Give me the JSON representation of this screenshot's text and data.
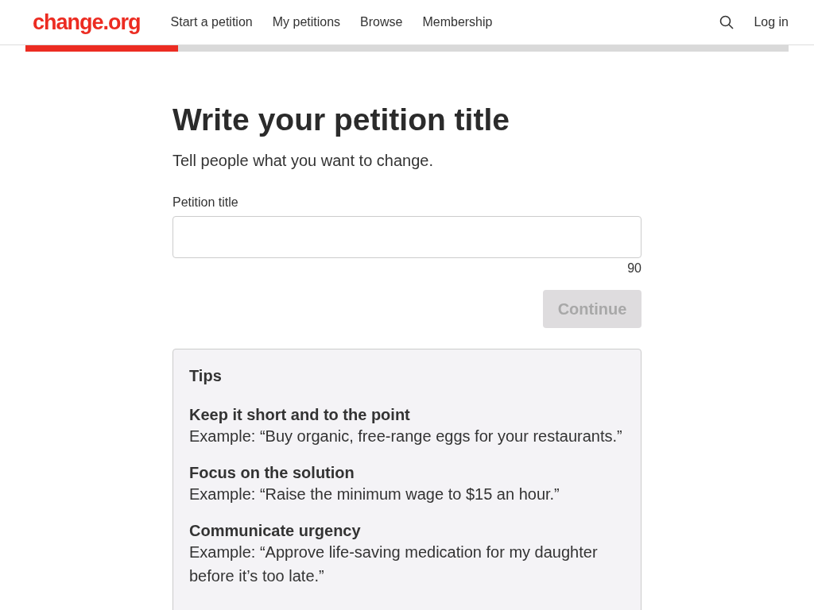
{
  "header": {
    "logo": "change.org",
    "nav": [
      {
        "label": "Start a petition"
      },
      {
        "label": "My petitions"
      },
      {
        "label": "Browse"
      },
      {
        "label": "Membership"
      }
    ],
    "login": "Log in"
  },
  "progress": {
    "level": 0.2
  },
  "heading": "Write your petition title",
  "subtitle": "Tell people what you want to change.",
  "field": {
    "label": "Petition title",
    "counter": "90"
  },
  "continue_button": {
    "label": "Continue",
    "disabled": true
  },
  "tips": {
    "title": "Tips",
    "items": [
      {
        "title": "Keep it short and to the point",
        "text": "Example: “Buy organic, free-range eggs for your restaurants.”"
      },
      {
        "title": "Focus on the solution",
        "text": "Example: “Raise the minimum wage to $15 an hour.”"
      },
      {
        "title": "Communicate urgency",
        "text": "Example: “Approve life-saving medication for my daughter before it’s too late.”"
      }
    ]
  }
}
